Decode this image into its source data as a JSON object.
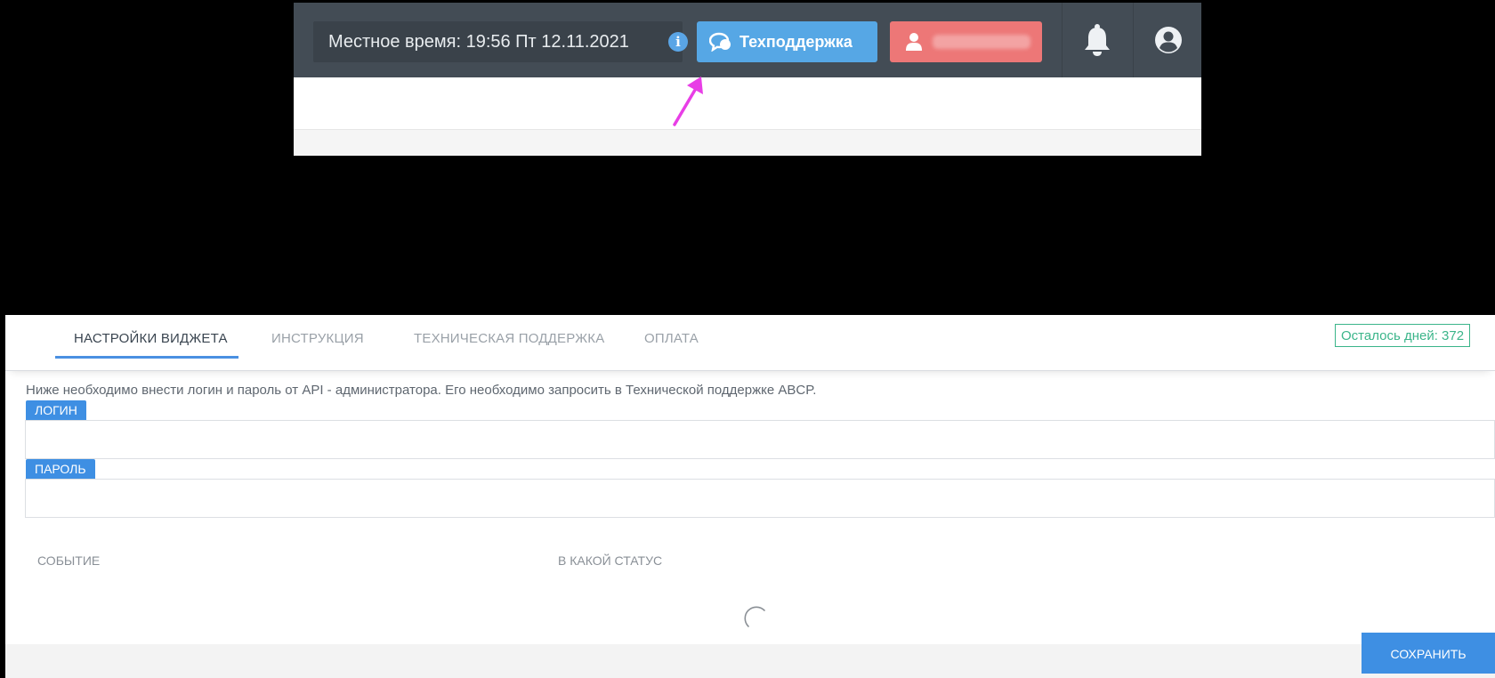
{
  "header": {
    "local_time": "Местное время: 19:56 Пт 12.11.2021",
    "support_button": "Техподдержка",
    "icons": [
      "info-icon",
      "chat-support-icon",
      "user-icon",
      "bell-icon",
      "account-circle-icon"
    ]
  },
  "tabs": [
    {
      "label": "НАСТРОЙКИ ВИДЖЕТА",
      "active": true
    },
    {
      "label": "ИНСТРУКЦИЯ",
      "active": false
    },
    {
      "label": "ТЕХНИЧЕСКАЯ ПОДДЕРЖКА",
      "active": false
    },
    {
      "label": "ОПЛАТА",
      "active": false
    }
  ],
  "days_left": "Осталось дней: 372",
  "instructions": "Ниже необходимо внести логин и пароль от API - администратора. Его необходимо запросить в Технической поддержке ABCP.",
  "login": {
    "label": "ЛОГИН",
    "value": ""
  },
  "password": {
    "label": "ПАРОЛЬ",
    "value": ""
  },
  "table": {
    "columns": [
      "СОБЫТИЕ",
      "В КАКОЙ СТАТУС"
    ]
  },
  "save_button": "СОХРАНИТЬ",
  "colors": {
    "header_bg": "#434c55",
    "support_btn": "#56a7e5",
    "user_btn": "#ed7777",
    "accent": "#3e8fe3",
    "days_badge": "#3bb58a",
    "annotation_arrow": "#e83ee6"
  }
}
